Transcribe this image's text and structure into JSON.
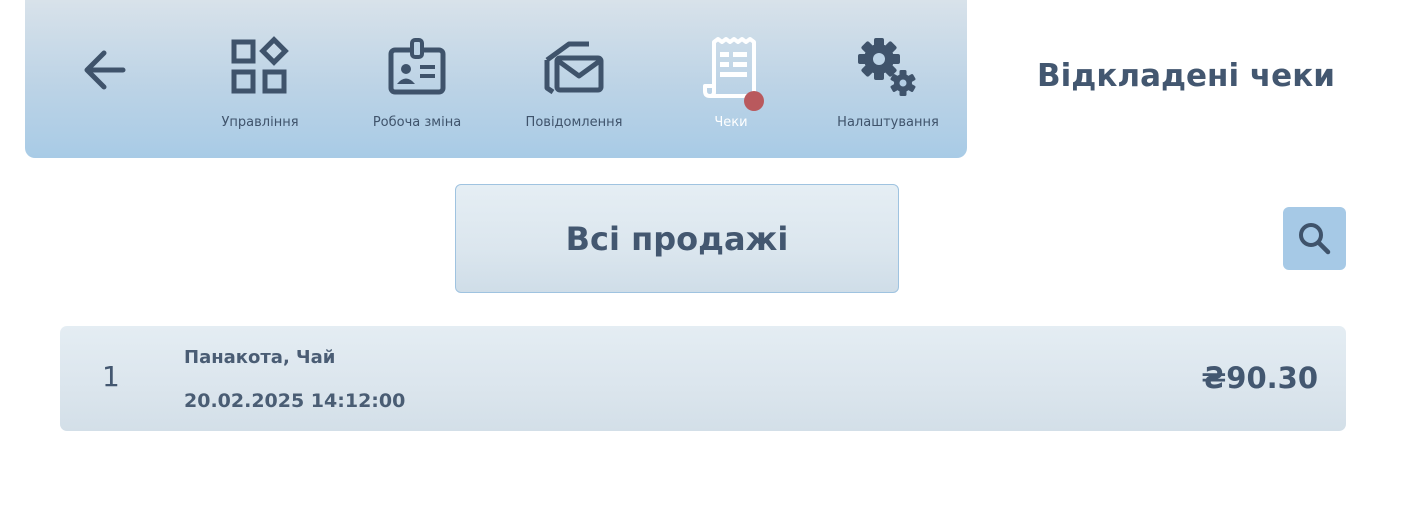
{
  "toolbar": {
    "nav": [
      {
        "label": "Управління",
        "icon": "grid-shapes-icon"
      },
      {
        "label": "Робоча зміна",
        "icon": "id-badge-icon"
      },
      {
        "label": "Повідомлення",
        "icon": "envelope-icon"
      },
      {
        "label": "Чеки",
        "icon": "receipt-icon",
        "active": true,
        "badge": true
      },
      {
        "label": "Налаштування",
        "icon": "gears-icon"
      }
    ]
  },
  "header": {
    "title": "Відкладені чеки"
  },
  "filter": {
    "all_sales_label": "Всі продажі"
  },
  "receipts": [
    {
      "number": "1",
      "items": "Панакота, Чай",
      "datetime": "20.02.2025 14:12:00",
      "amount": "₴90.30"
    }
  ],
  "colors": {
    "text": "#435770",
    "toolbar_bg": "#bcd3e6",
    "active_icon": "#ffffff",
    "badge": "#b9595d",
    "search_button": "#a6c9e6"
  }
}
